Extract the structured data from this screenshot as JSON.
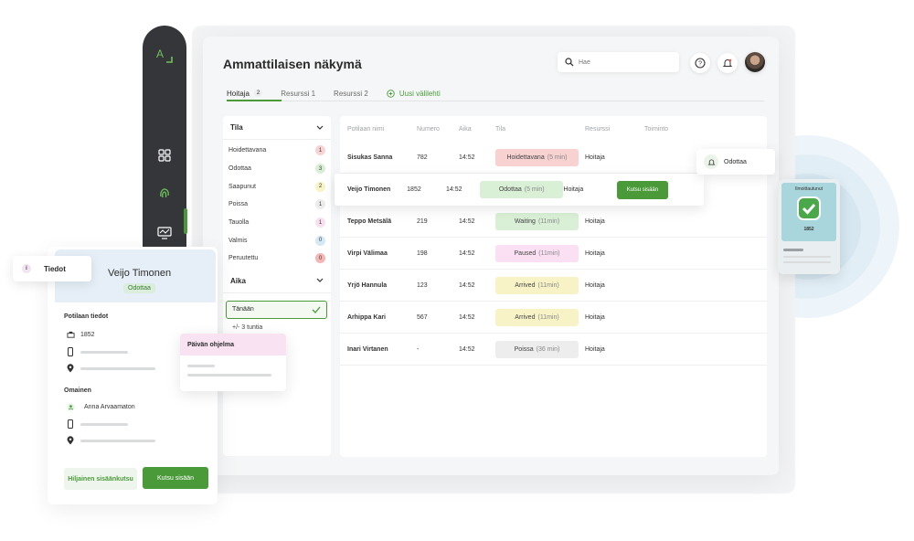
{
  "app": {
    "title": "Ammattilaisen näkymä",
    "search_placeholder": "Hae"
  },
  "tabs": [
    {
      "label": "Hoitaja",
      "count": "2"
    },
    {
      "label": "Resurssi 1"
    },
    {
      "label": "Resurssi 2"
    }
  ],
  "new_tab_label": "Uusi välilehti",
  "filters": {
    "status_heading": "Tila",
    "statuses": [
      {
        "label": "Hoidettavana",
        "count": "1",
        "color": "#f7d3d3"
      },
      {
        "label": "Odottaa",
        "count": "3",
        "color": "#d8efd6"
      },
      {
        "label": "Saapunut",
        "count": "2",
        "color": "#f6f3c7"
      },
      {
        "label": "Poissa",
        "count": "1",
        "color": "#ececec"
      },
      {
        "label": "Tauolla",
        "count": "1",
        "color": "#f9e0f0"
      },
      {
        "label": "Valmis",
        "count": "0",
        "color": "#d4e9f4"
      },
      {
        "label": "Peruutettu",
        "count": "0",
        "color": "#f6b4b4"
      }
    ],
    "time_heading": "Aika",
    "today_label": "Tänään",
    "range_label": "+/- 3 tuntia"
  },
  "table": {
    "headers": [
      "Potilaan nimi",
      "Numero",
      "Aika",
      "Tila",
      "Resurssi",
      "Toiminto"
    ],
    "rows": [
      {
        "name": "Sisukas Sanna",
        "number": "782",
        "time": "14:52",
        "status": "Hoidettavana",
        "status_sub": "(5 min)",
        "status_color": "#f8d1d1",
        "resource": "Hoitaja"
      },
      {
        "name": "Veijo Timonen",
        "number": "1852",
        "time": "14:52",
        "status": "Odottaa",
        "status_sub": "(5 min)",
        "status_color": "#d9efd6",
        "resource": "Hoitaja",
        "action": "Kutsu sisään"
      },
      {
        "name": "Teppo Metsälä",
        "number": "219",
        "time": "14:52",
        "status": "Waiting",
        "status_sub": "(11min)",
        "status_color": "#d9efd6",
        "resource": "Hoitaja"
      },
      {
        "name": "Virpi Välimaa",
        "number": "198",
        "time": "14:52",
        "status": "Paused",
        "status_sub": "(11min)",
        "status_color": "#fae0f2",
        "resource": "Hoitaja"
      },
      {
        "name": "Yrjö Hannula",
        "number": "123",
        "time": "14:52",
        "status": "Arrived",
        "status_sub": "(11min)",
        "status_color": "#f7f3c6",
        "resource": "Hoitaja"
      },
      {
        "name": "Arhippa Kari",
        "number": "567",
        "time": "14:52",
        "status": "Arrived",
        "status_sub": "(11min)",
        "status_color": "#f7f3c6",
        "resource": "Hoitaja"
      },
      {
        "name": "Inari Virtanen",
        "number": "-",
        "time": "14:52",
        "status": "Poissa",
        "status_sub": "(36 min)",
        "status_color": "#ededed",
        "resource": "Hoitaja"
      }
    ]
  },
  "detail": {
    "tab_label": "Tiedot",
    "name": "Veijo Timonen",
    "status": "Odottaa",
    "patient_heading": "Potilaan tiedot",
    "patient_number": "1852",
    "relative_heading": "Omainen",
    "relative_name": "Anna Arvaamaton",
    "quiet_button": "Hiljainen sisäänkutsu",
    "call_button": "Kutsu sisään"
  },
  "program": {
    "title": "Päivän ohjelma"
  },
  "notification": {
    "label": "Odottaa"
  },
  "kiosk": {
    "title": "Ilmoittautunut",
    "number": "1852"
  },
  "colors": {
    "accent": "#4a9a3a",
    "sidebar": "#34363a"
  }
}
